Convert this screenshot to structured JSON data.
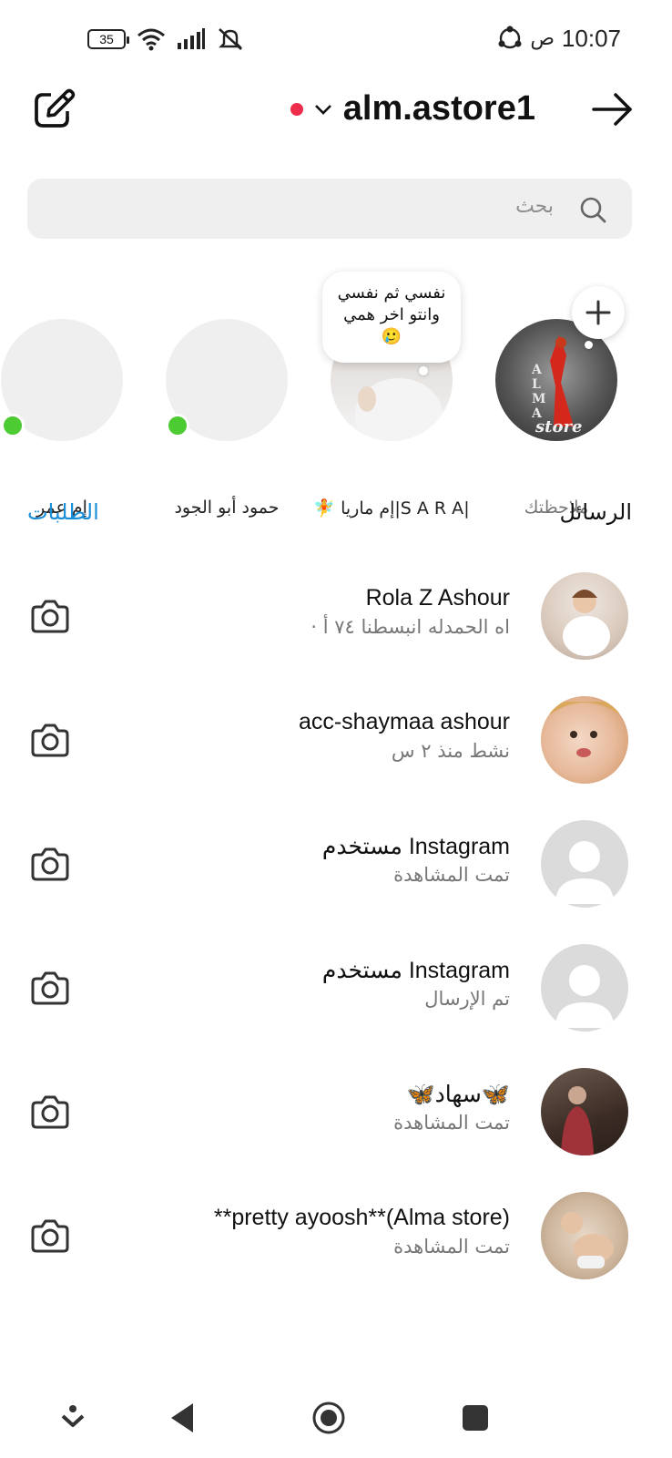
{
  "status_bar": {
    "battery": "35",
    "time": "10:07",
    "ampm": "ص"
  },
  "header": {
    "title": "alm.astore1"
  },
  "search": {
    "placeholder": "بحث"
  },
  "notes": {
    "bubble_text_line1": "نفسي ثم نفسي",
    "bubble_text_line2": "وانتو اخر همي",
    "bubble_emoji": "🥲",
    "items": [
      {
        "label": "ملاحظتك"
      },
      {
        "label": "|S A R A|إم ماريا 🧚"
      },
      {
        "label": "حمود أبو الجود"
      },
      {
        "label": "إم عمر"
      }
    ]
  },
  "section": {
    "title": "الرسائل",
    "requests": "الطلبات"
  },
  "messages": [
    {
      "name": "Rola Z Ashour",
      "sub": "اه الحمدله انبسطنا ٧٤ أ ·"
    },
    {
      "name": "acc-shaymaa ashour",
      "sub": "نشط منذ ٢ س"
    },
    {
      "name": "مستخدم Instagram",
      "sub": "تمت المشاهدة"
    },
    {
      "name": "مستخدم Instagram",
      "sub": "تم الإرسال"
    },
    {
      "name": "🦋سهاد🦋",
      "sub": "تمت المشاهدة"
    },
    {
      "name": "**pretty ayoosh**(Alma store)",
      "sub": "تمت المشاهدة"
    }
  ],
  "colors": {
    "accent_link": "#1a8ed8",
    "online": "#4dcb32",
    "live_dot": "#ed2d4b"
  }
}
